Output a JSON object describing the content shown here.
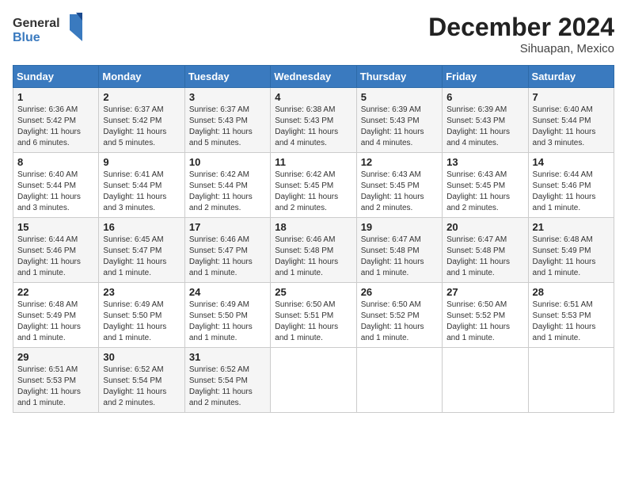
{
  "logo": {
    "general": "General",
    "blue": "Blue"
  },
  "title": "December 2024",
  "location": "Sihuapan, Mexico",
  "days_of_week": [
    "Sunday",
    "Monday",
    "Tuesday",
    "Wednesday",
    "Thursday",
    "Friday",
    "Saturday"
  ],
  "weeks": [
    [
      {
        "day": "1",
        "sunrise": "6:36 AM",
        "sunset": "5:42 PM",
        "daylight": "11 hours and 6 minutes."
      },
      {
        "day": "2",
        "sunrise": "6:37 AM",
        "sunset": "5:42 PM",
        "daylight": "11 hours and 5 minutes."
      },
      {
        "day": "3",
        "sunrise": "6:37 AM",
        "sunset": "5:43 PM",
        "daylight": "11 hours and 5 minutes."
      },
      {
        "day": "4",
        "sunrise": "6:38 AM",
        "sunset": "5:43 PM",
        "daylight": "11 hours and 4 minutes."
      },
      {
        "day": "5",
        "sunrise": "6:39 AM",
        "sunset": "5:43 PM",
        "daylight": "11 hours and 4 minutes."
      },
      {
        "day": "6",
        "sunrise": "6:39 AM",
        "sunset": "5:43 PM",
        "daylight": "11 hours and 4 minutes."
      },
      {
        "day": "7",
        "sunrise": "6:40 AM",
        "sunset": "5:44 PM",
        "daylight": "11 hours and 3 minutes."
      }
    ],
    [
      {
        "day": "8",
        "sunrise": "6:40 AM",
        "sunset": "5:44 PM",
        "daylight": "11 hours and 3 minutes."
      },
      {
        "day": "9",
        "sunrise": "6:41 AM",
        "sunset": "5:44 PM",
        "daylight": "11 hours and 3 minutes."
      },
      {
        "day": "10",
        "sunrise": "6:42 AM",
        "sunset": "5:44 PM",
        "daylight": "11 hours and 2 minutes."
      },
      {
        "day": "11",
        "sunrise": "6:42 AM",
        "sunset": "5:45 PM",
        "daylight": "11 hours and 2 minutes."
      },
      {
        "day": "12",
        "sunrise": "6:43 AM",
        "sunset": "5:45 PM",
        "daylight": "11 hours and 2 minutes."
      },
      {
        "day": "13",
        "sunrise": "6:43 AM",
        "sunset": "5:45 PM",
        "daylight": "11 hours and 2 minutes."
      },
      {
        "day": "14",
        "sunrise": "6:44 AM",
        "sunset": "5:46 PM",
        "daylight": "11 hours and 1 minute."
      }
    ],
    [
      {
        "day": "15",
        "sunrise": "6:44 AM",
        "sunset": "5:46 PM",
        "daylight": "11 hours and 1 minute."
      },
      {
        "day": "16",
        "sunrise": "6:45 AM",
        "sunset": "5:47 PM",
        "daylight": "11 hours and 1 minute."
      },
      {
        "day": "17",
        "sunrise": "6:46 AM",
        "sunset": "5:47 PM",
        "daylight": "11 hours and 1 minute."
      },
      {
        "day": "18",
        "sunrise": "6:46 AM",
        "sunset": "5:48 PM",
        "daylight": "11 hours and 1 minute."
      },
      {
        "day": "19",
        "sunrise": "6:47 AM",
        "sunset": "5:48 PM",
        "daylight": "11 hours and 1 minute."
      },
      {
        "day": "20",
        "sunrise": "6:47 AM",
        "sunset": "5:48 PM",
        "daylight": "11 hours and 1 minute."
      },
      {
        "day": "21",
        "sunrise": "6:48 AM",
        "sunset": "5:49 PM",
        "daylight": "11 hours and 1 minute."
      }
    ],
    [
      {
        "day": "22",
        "sunrise": "6:48 AM",
        "sunset": "5:49 PM",
        "daylight": "11 hours and 1 minute."
      },
      {
        "day": "23",
        "sunrise": "6:49 AM",
        "sunset": "5:50 PM",
        "daylight": "11 hours and 1 minute."
      },
      {
        "day": "24",
        "sunrise": "6:49 AM",
        "sunset": "5:50 PM",
        "daylight": "11 hours and 1 minute."
      },
      {
        "day": "25",
        "sunrise": "6:50 AM",
        "sunset": "5:51 PM",
        "daylight": "11 hours and 1 minute."
      },
      {
        "day": "26",
        "sunrise": "6:50 AM",
        "sunset": "5:52 PM",
        "daylight": "11 hours and 1 minute."
      },
      {
        "day": "27",
        "sunrise": "6:50 AM",
        "sunset": "5:52 PM",
        "daylight": "11 hours and 1 minute."
      },
      {
        "day": "28",
        "sunrise": "6:51 AM",
        "sunset": "5:53 PM",
        "daylight": "11 hours and 1 minute."
      }
    ],
    [
      {
        "day": "29",
        "sunrise": "6:51 AM",
        "sunset": "5:53 PM",
        "daylight": "11 hours and 1 minute."
      },
      {
        "day": "30",
        "sunrise": "6:52 AM",
        "sunset": "5:54 PM",
        "daylight": "11 hours and 2 minutes."
      },
      {
        "day": "31",
        "sunrise": "6:52 AM",
        "sunset": "5:54 PM",
        "daylight": "11 hours and 2 minutes."
      },
      null,
      null,
      null,
      null
    ]
  ],
  "labels": {
    "sunrise_prefix": "Sunrise: ",
    "sunset_prefix": "Sunset: ",
    "daylight_prefix": "Daylight: "
  }
}
